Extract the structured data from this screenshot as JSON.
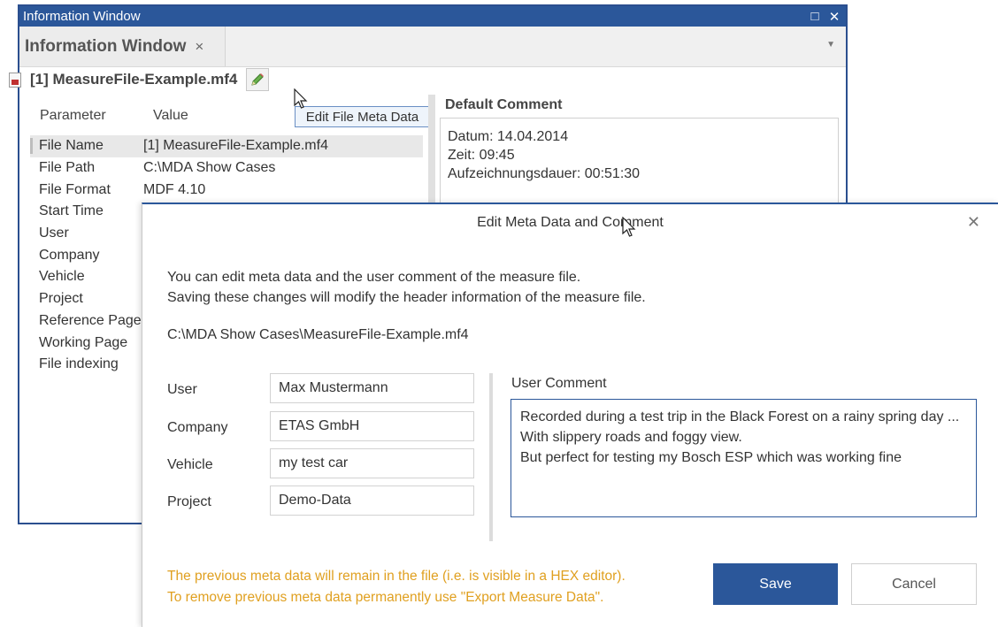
{
  "info_window": {
    "title": "Information Window",
    "maximize_glyph": "□",
    "close_glyph": "✕",
    "tab": {
      "label": "Information Window",
      "close_glyph": "×"
    },
    "tab_menu_glyph": "▼",
    "file_header": "[1] MeasureFile-Example.mf4",
    "tooltip": "Edit File Meta Data",
    "columns": {
      "parameter": "Parameter",
      "value": "Value"
    },
    "rows": [
      {
        "name": "File Name",
        "value": "[1] MeasureFile-Example.mf4",
        "selected": true
      },
      {
        "name": "File Path",
        "value": "C:\\MDA Show Cases"
      },
      {
        "name": "File Format",
        "value": "MDF 4.10"
      },
      {
        "name": "Start Time",
        "value": ""
      },
      {
        "name": "User",
        "value": ""
      },
      {
        "name": "Company",
        "value": ""
      },
      {
        "name": "Vehicle",
        "value": ""
      },
      {
        "name": "Project",
        "value": ""
      },
      {
        "name": "Reference Page",
        "value": ""
      },
      {
        "name": "Working Page",
        "value": ""
      },
      {
        "name": "File indexing",
        "value": ""
      }
    ],
    "default_comment_label": "Default Comment",
    "default_comment_lines": [
      "Datum: 14.04.2014",
      "Zeit: 09:45",
      "Aufzeichnungsdauer: 00:51:30"
    ]
  },
  "dialog": {
    "title": "Edit Meta Data and Comment",
    "close_glyph": "✕",
    "desc_line1": "You can edit meta data and the user comment of the measure file.",
    "desc_line2": "Saving these changes will modify the header information of the measure file.",
    "path": "C:\\MDA Show Cases\\MeasureFile-Example.mf4",
    "fields": [
      {
        "label": "User",
        "value": "Max Mustermann"
      },
      {
        "label": "Company",
        "value": "ETAS GmbH"
      },
      {
        "label": "Vehicle",
        "value": "my test car"
      },
      {
        "label": "Project",
        "value": "Demo-Data"
      }
    ],
    "user_comment_label": "User Comment",
    "user_comment": "Recorded during a test trip in the Black Forest on a rainy spring day ...\nWith slippery roads and foggy view.\nBut perfect for testing my Bosch ESP which was working fine",
    "warning_line1": "The previous meta data will remain in the file (i.e. is visible in a HEX editor).",
    "warning_line2": "To remove previous meta data permanently use \"Export Measure Data\".",
    "save_label": "Save",
    "cancel_label": "Cancel"
  },
  "colors": {
    "accent": "#2b579a",
    "warning": "#e0a020"
  },
  "icons": {
    "file": "file-icon",
    "edit": "pencil-icon",
    "cursor": "mouse-pointer-icon"
  }
}
